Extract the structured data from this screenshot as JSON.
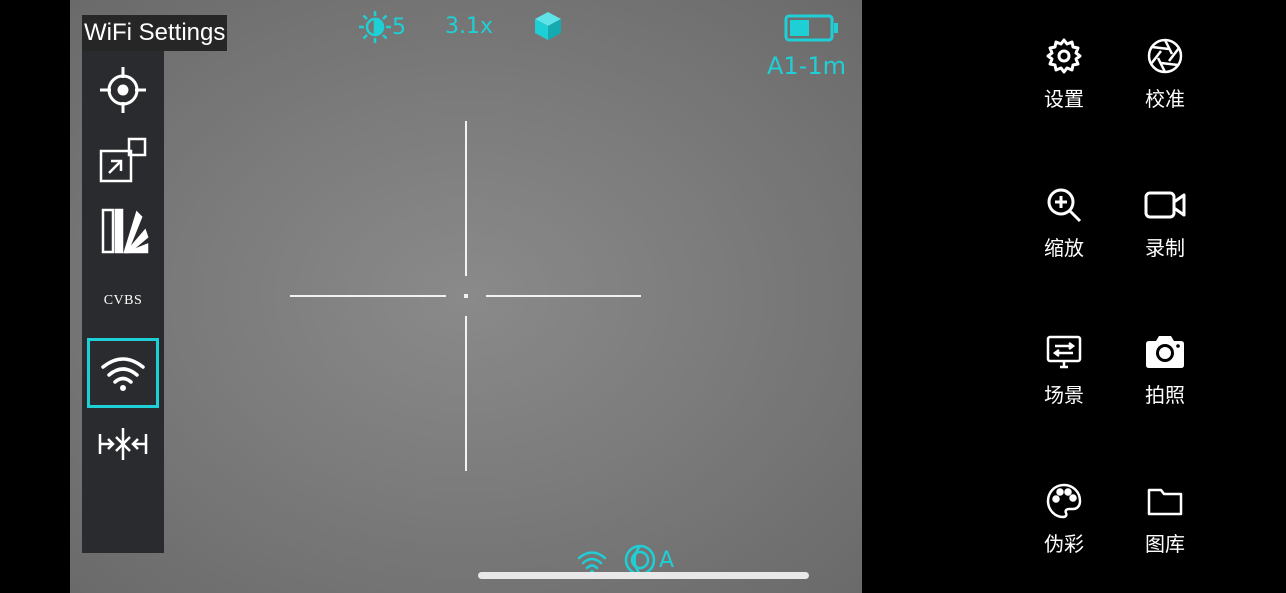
{
  "viewport": {
    "mode_title": "WiFi Settings",
    "brightness_value": "5",
    "zoom_value": "3.1x",
    "profile_label": "A1-1m",
    "battery_level": 0.5,
    "bottom_mode_letter": "A",
    "accent_color": "#1fcfd6"
  },
  "side_menu": {
    "items": [
      {
        "name": "reticle",
        "icon": "crosshair-icon"
      },
      {
        "name": "picture-in-picture",
        "icon": "pip-icon"
      },
      {
        "name": "image-enhance",
        "icon": "enhance-icon"
      },
      {
        "name": "cvbs",
        "label": "CVBS"
      },
      {
        "name": "wifi",
        "icon": "wifi-icon",
        "selected": true
      },
      {
        "name": "distance",
        "icon": "distance-icon"
      }
    ]
  },
  "right_panel": {
    "buttons": [
      {
        "label": "设置",
        "icon": "gear-icon"
      },
      {
        "label": "校准",
        "icon": "aperture-icon"
      },
      {
        "label": "缩放",
        "icon": "zoom-in-icon"
      },
      {
        "label": "录制",
        "icon": "video-camera-icon"
      },
      {
        "label": "场景",
        "icon": "scene-icon"
      },
      {
        "label": "拍照",
        "icon": "camera-icon"
      },
      {
        "label": "伪彩",
        "icon": "palette-icon"
      },
      {
        "label": "图库",
        "icon": "folder-icon"
      }
    ]
  }
}
